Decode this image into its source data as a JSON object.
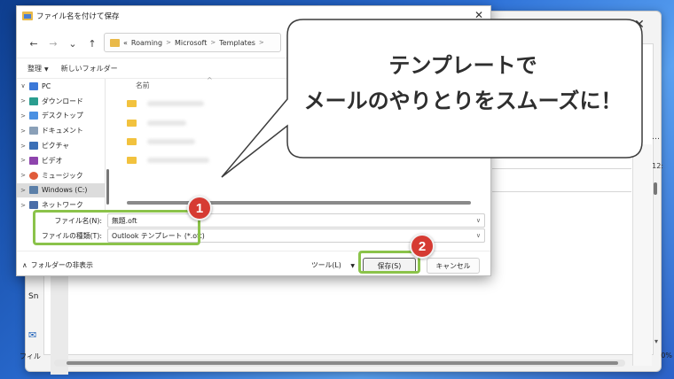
{
  "dialog": {
    "title": "ファイル名を付けて保存",
    "close_glyph": "✕",
    "nav": {
      "back": "←",
      "forward": "→",
      "up_menu": "⌄",
      "up": "↑"
    },
    "address": {
      "overflow": "«",
      "segments": [
        "Roaming",
        "Microsoft",
        "Templates"
      ],
      "sep": ">"
    },
    "toolbar": {
      "organize": "整理",
      "new_folder": "新しいフォルダー"
    },
    "tree": [
      {
        "label": "PC",
        "chev": "∨",
        "icon_color": "#3b78d8"
      },
      {
        "label": "ダウンロード",
        "chev": ">",
        "icon_color": "#2a9d8f"
      },
      {
        "label": "デスクトップ",
        "chev": ">",
        "icon_color": "#4a90e2"
      },
      {
        "label": "ドキュメント",
        "chev": ">",
        "icon_color": "#8aa0b8"
      },
      {
        "label": "ピクチャ",
        "chev": ">",
        "icon_color": "#3b6fb6"
      },
      {
        "label": "ビデオ",
        "chev": ">",
        "icon_color": "#8e44ad"
      },
      {
        "label": "ミュージック",
        "chev": ">",
        "icon_color": "#e05b3a"
      },
      {
        "label": "Windows (C:)",
        "chev": ">",
        "icon_color": "#5b7fa8"
      },
      {
        "label": "ネットワーク",
        "chev": ">",
        "icon_color": "#4a6ea8"
      }
    ],
    "file_list": {
      "column_name": "名前",
      "sort_caret": "^"
    },
    "filename_label": "ファイル名(N):",
    "filename_value": "無題.oft",
    "filetype_label": "ファイルの種類(T):",
    "filetype_value": "Outlook テンプレート (*.oft)",
    "dropdown_caret": "∨",
    "hide_folders": "フォルダーの非表示",
    "hide_folders_caret": "∧",
    "tools_label": "ツール(L)",
    "tools_caret": "▼",
    "save_label": "保存(S)",
    "cancel_label": "キャンセル"
  },
  "back_window": {
    "close_glyph": "✕",
    "dots": "…",
    "time": "12:",
    "left_sn": "Sn",
    "left_label": "フィル",
    "right_pct": "0%",
    "scroll_arrow": "▾"
  },
  "annotations": {
    "badge_1": "1",
    "badge_2": "2",
    "bubble_line_1": "テンプレートで",
    "bubble_line_2": "メールのやりとりをスムーズに！",
    "highlight_color": "#8bc34a",
    "badge_color": "#d63b33"
  }
}
